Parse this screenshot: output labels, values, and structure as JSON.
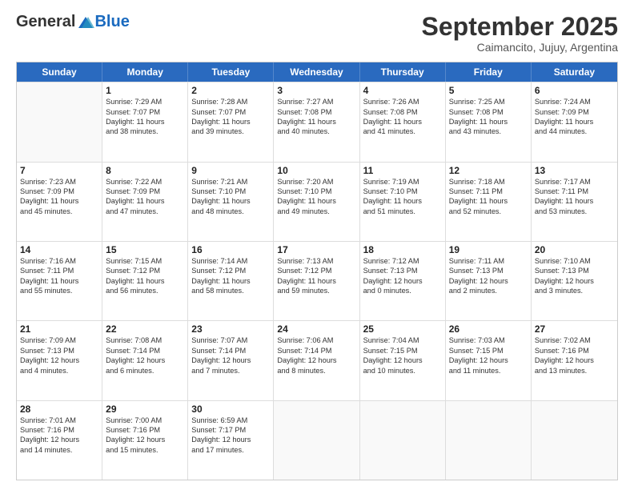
{
  "header": {
    "logo_general": "General",
    "logo_blue": "Blue",
    "month_title": "September 2025",
    "subtitle": "Caimancito, Jujuy, Argentina"
  },
  "days_of_week": [
    "Sunday",
    "Monday",
    "Tuesday",
    "Wednesday",
    "Thursday",
    "Friday",
    "Saturday"
  ],
  "weeks": [
    [
      {
        "day": "",
        "info": ""
      },
      {
        "day": "1",
        "info": "Sunrise: 7:29 AM\nSunset: 7:07 PM\nDaylight: 11 hours\nand 38 minutes."
      },
      {
        "day": "2",
        "info": "Sunrise: 7:28 AM\nSunset: 7:07 PM\nDaylight: 11 hours\nand 39 minutes."
      },
      {
        "day": "3",
        "info": "Sunrise: 7:27 AM\nSunset: 7:08 PM\nDaylight: 11 hours\nand 40 minutes."
      },
      {
        "day": "4",
        "info": "Sunrise: 7:26 AM\nSunset: 7:08 PM\nDaylight: 11 hours\nand 41 minutes."
      },
      {
        "day": "5",
        "info": "Sunrise: 7:25 AM\nSunset: 7:08 PM\nDaylight: 11 hours\nand 43 minutes."
      },
      {
        "day": "6",
        "info": "Sunrise: 7:24 AM\nSunset: 7:09 PM\nDaylight: 11 hours\nand 44 minutes."
      }
    ],
    [
      {
        "day": "7",
        "info": "Sunrise: 7:23 AM\nSunset: 7:09 PM\nDaylight: 11 hours\nand 45 minutes."
      },
      {
        "day": "8",
        "info": "Sunrise: 7:22 AM\nSunset: 7:09 PM\nDaylight: 11 hours\nand 47 minutes."
      },
      {
        "day": "9",
        "info": "Sunrise: 7:21 AM\nSunset: 7:10 PM\nDaylight: 11 hours\nand 48 minutes."
      },
      {
        "day": "10",
        "info": "Sunrise: 7:20 AM\nSunset: 7:10 PM\nDaylight: 11 hours\nand 49 minutes."
      },
      {
        "day": "11",
        "info": "Sunrise: 7:19 AM\nSunset: 7:10 PM\nDaylight: 11 hours\nand 51 minutes."
      },
      {
        "day": "12",
        "info": "Sunrise: 7:18 AM\nSunset: 7:11 PM\nDaylight: 11 hours\nand 52 minutes."
      },
      {
        "day": "13",
        "info": "Sunrise: 7:17 AM\nSunset: 7:11 PM\nDaylight: 11 hours\nand 53 minutes."
      }
    ],
    [
      {
        "day": "14",
        "info": "Sunrise: 7:16 AM\nSunset: 7:11 PM\nDaylight: 11 hours\nand 55 minutes."
      },
      {
        "day": "15",
        "info": "Sunrise: 7:15 AM\nSunset: 7:12 PM\nDaylight: 11 hours\nand 56 minutes."
      },
      {
        "day": "16",
        "info": "Sunrise: 7:14 AM\nSunset: 7:12 PM\nDaylight: 11 hours\nand 58 minutes."
      },
      {
        "day": "17",
        "info": "Sunrise: 7:13 AM\nSunset: 7:12 PM\nDaylight: 11 hours\nand 59 minutes."
      },
      {
        "day": "18",
        "info": "Sunrise: 7:12 AM\nSunset: 7:13 PM\nDaylight: 12 hours\nand 0 minutes."
      },
      {
        "day": "19",
        "info": "Sunrise: 7:11 AM\nSunset: 7:13 PM\nDaylight: 12 hours\nand 2 minutes."
      },
      {
        "day": "20",
        "info": "Sunrise: 7:10 AM\nSunset: 7:13 PM\nDaylight: 12 hours\nand 3 minutes."
      }
    ],
    [
      {
        "day": "21",
        "info": "Sunrise: 7:09 AM\nSunset: 7:13 PM\nDaylight: 12 hours\nand 4 minutes."
      },
      {
        "day": "22",
        "info": "Sunrise: 7:08 AM\nSunset: 7:14 PM\nDaylight: 12 hours\nand 6 minutes."
      },
      {
        "day": "23",
        "info": "Sunrise: 7:07 AM\nSunset: 7:14 PM\nDaylight: 12 hours\nand 7 minutes."
      },
      {
        "day": "24",
        "info": "Sunrise: 7:06 AM\nSunset: 7:14 PM\nDaylight: 12 hours\nand 8 minutes."
      },
      {
        "day": "25",
        "info": "Sunrise: 7:04 AM\nSunset: 7:15 PM\nDaylight: 12 hours\nand 10 minutes."
      },
      {
        "day": "26",
        "info": "Sunrise: 7:03 AM\nSunset: 7:15 PM\nDaylight: 12 hours\nand 11 minutes."
      },
      {
        "day": "27",
        "info": "Sunrise: 7:02 AM\nSunset: 7:16 PM\nDaylight: 12 hours\nand 13 minutes."
      }
    ],
    [
      {
        "day": "28",
        "info": "Sunrise: 7:01 AM\nSunset: 7:16 PM\nDaylight: 12 hours\nand 14 minutes."
      },
      {
        "day": "29",
        "info": "Sunrise: 7:00 AM\nSunset: 7:16 PM\nDaylight: 12 hours\nand 15 minutes."
      },
      {
        "day": "30",
        "info": "Sunrise: 6:59 AM\nSunset: 7:17 PM\nDaylight: 12 hours\nand 17 minutes."
      },
      {
        "day": "",
        "info": ""
      },
      {
        "day": "",
        "info": ""
      },
      {
        "day": "",
        "info": ""
      },
      {
        "day": "",
        "info": ""
      }
    ]
  ]
}
